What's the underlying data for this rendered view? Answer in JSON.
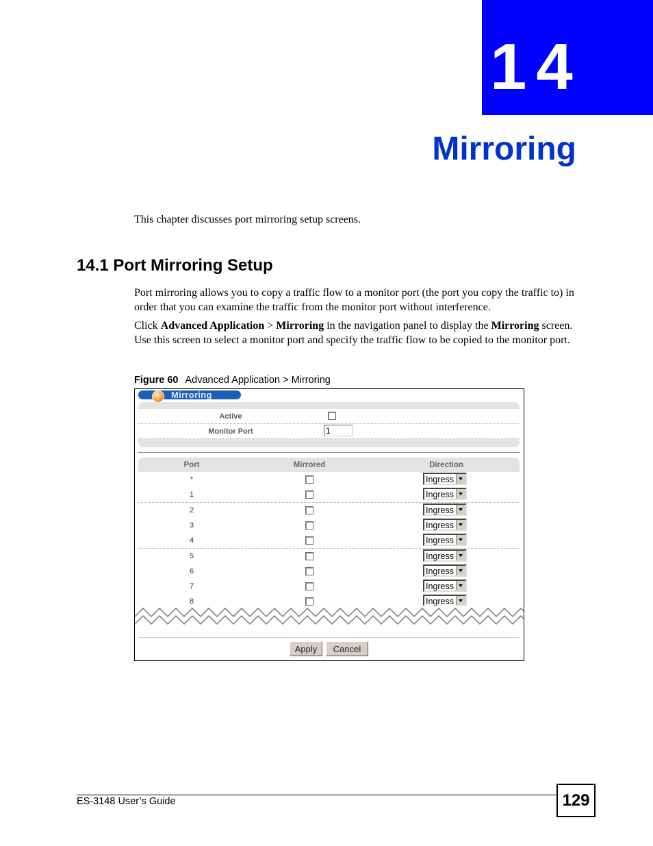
{
  "chapter": {
    "number": "14",
    "title": "Mirroring"
  },
  "intro": "This chapter discusses port mirroring setup screens.",
  "section": {
    "title": "14.1  Port Mirroring Setup"
  },
  "paragraphs": {
    "p1": "Port mirroring allows you to copy a traffic flow to a monitor port (the port you copy the traffic to) in order that you can examine the traffic from the monitor port without interference.",
    "p2": {
      "t1": "Click ",
      "b1": "Advanced Application",
      "t2": " > ",
      "b2": "Mirroring",
      "t3": " in the navigation panel to display the ",
      "b3": "Mirroring",
      "t4": " screen. Use this screen to select a monitor port and specify the traffic flow to be copied to the monitor port."
    }
  },
  "figure": {
    "label": "Figure 60",
    "caption": "Advanced Application > Mirroring",
    "screen_title": "Mirroring",
    "active_label": "Active",
    "active_checked": false,
    "monitor_port_label": "Monitor Port",
    "monitor_port_value": "1",
    "table": {
      "headers": {
        "port": "Port",
        "mirrored": "Mirrored",
        "direction": "Direction"
      },
      "rows": [
        {
          "port": "*",
          "mirrored": false,
          "direction": "Ingress"
        },
        {
          "port": "1",
          "mirrored": false,
          "direction": "Ingress"
        },
        {
          "port": "2",
          "mirrored": false,
          "direction": "Ingress"
        },
        {
          "port": "3",
          "mirrored": false,
          "direction": "Ingress"
        },
        {
          "port": "4",
          "mirrored": false,
          "direction": "Ingress"
        },
        {
          "port": "5",
          "mirrored": false,
          "direction": "Ingress"
        },
        {
          "port": "6",
          "mirrored": false,
          "direction": "Ingress"
        },
        {
          "port": "7",
          "mirrored": false,
          "direction": "Ingress"
        },
        {
          "port": "8",
          "mirrored": false,
          "direction": "Ingress"
        }
      ]
    },
    "apply_label": "Apply",
    "cancel_label": "Cancel"
  },
  "footer": {
    "guide": "ES-3148 User’s Guide",
    "page": "129"
  }
}
